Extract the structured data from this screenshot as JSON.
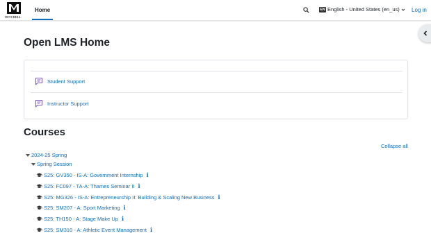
{
  "navbar": {
    "logo_text": "MITCHELL",
    "home_label": "Home",
    "search_icon": "search-icon",
    "language_badge": "EN",
    "language_label": "English - United States (en_us)",
    "login_label": "Log in"
  },
  "page": {
    "title": "Open LMS Home"
  },
  "support": {
    "items": [
      {
        "label": "Student Support",
        "icon": "chat-icon"
      },
      {
        "label": "Instructor Support",
        "icon": "chat-icon"
      }
    ]
  },
  "courses": {
    "title": "Courses",
    "collapse_all_label": "Collapse all",
    "category": "2024-25 Spring",
    "subcategory": "Spring Session",
    "list": [
      {
        "name": "S25: GV350 - IS-A: Government Internship"
      },
      {
        "name": "S25: FC097 - TA-A: Thames Seminar II"
      },
      {
        "name": "S25: MG326 - IS-A: Entrepreneurship II: Building & Scaling New Business"
      },
      {
        "name": "S25: SM207 - A: Sport Marketing"
      },
      {
        "name": "S25: TH150 - A: Stage Make Up"
      },
      {
        "name": "S25: SM310 - A: Athletic Event Management"
      }
    ],
    "info_glyph": "i"
  },
  "colors": {
    "link": "#0f6cbf",
    "text": "#1d2125",
    "support_icon": "#7e57c2"
  }
}
